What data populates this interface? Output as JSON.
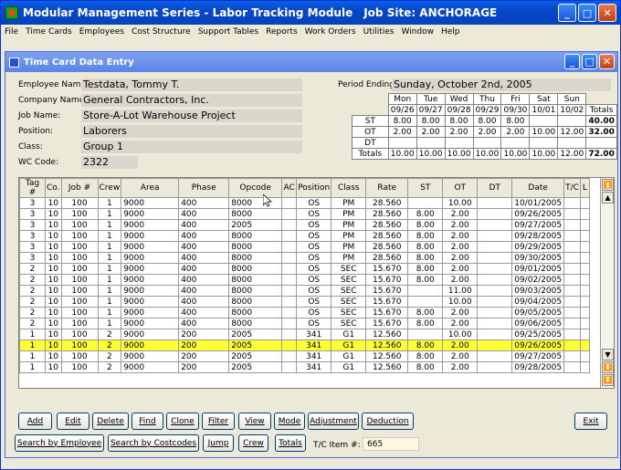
{
  "window": {
    "title": "Modular Management Series - Labor Tracking Module",
    "job_site": "Job Site: ANCHORAGE"
  },
  "menu": [
    "File",
    "Time Cards",
    "Employees",
    "Cost Structure",
    "Support Tables",
    "Reports",
    "Work Orders",
    "Utilities",
    "Window",
    "Help"
  ],
  "child": {
    "title": "Time Card Data Entry"
  },
  "employee": {
    "name_label": "Employee Name:",
    "name": "Testdata, Tommy T.",
    "company_label": "Company Name:",
    "company": "General Contractors, Inc.",
    "job_label": "Job Name:",
    "job": "Store-A-Lot Warehouse Project",
    "position_label": "Position:",
    "position": "Laborers",
    "class_label": "Class:",
    "class": "Group 1",
    "wc_label": "WC Code:",
    "wc": "2322"
  },
  "period": {
    "label": "Period Ending:",
    "value": "Sunday, October 2nd, 2005"
  },
  "hours": {
    "days": [
      "Mon",
      "Tue",
      "Wed",
      "Thu",
      "Fri",
      "Sat",
      "Sun"
    ],
    "dates": [
      "09/26",
      "09/27",
      "09/28",
      "09/29",
      "09/30",
      "10/01",
      "10/02"
    ],
    "totals_label": "Totals",
    "rows": [
      {
        "label": "ST",
        "values": [
          "8.00",
          "8.00",
          "8.00",
          "8.00",
          "8.00",
          "",
          ""
        ],
        "total": "40.00"
      },
      {
        "label": "OT",
        "values": [
          "2.00",
          "2.00",
          "2.00",
          "2.00",
          "2.00",
          "10.00",
          "12.00"
        ],
        "total": "32.00"
      },
      {
        "label": "DT",
        "values": [
          "",
          "",
          "",
          "",
          "",
          "",
          ""
        ],
        "total": ""
      },
      {
        "label": "Totals",
        "values": [
          "10.00",
          "10.00",
          "10.00",
          "10.00",
          "10.00",
          "10.00",
          "12.00"
        ],
        "total": "72.00"
      }
    ]
  },
  "grid": {
    "columns": [
      "Tag #",
      "Co.",
      "Job #",
      "Crew",
      "Area",
      "Phase",
      "Opcode",
      "AC",
      "Position",
      "Class",
      "Rate",
      "ST",
      "OT",
      "DT",
      "Date",
      "T/C",
      "L"
    ],
    "rows": [
      [
        "3",
        "10",
        "100",
        "1",
        "9000",
        "400",
        "8000",
        "",
        "OS",
        "PM",
        "28.560",
        "",
        "10.00",
        "",
        "10/01/2005",
        "",
        ""
      ],
      [
        "3",
        "10",
        "100",
        "1",
        "9000",
        "400",
        "8000",
        "",
        "OS",
        "PM",
        "28.560",
        "8.00",
        "2.00",
        "",
        "09/26/2005",
        "",
        ""
      ],
      [
        "3",
        "10",
        "100",
        "1",
        "9000",
        "400",
        "2005",
        "",
        "OS",
        "PM",
        "28.560",
        "8.00",
        "2.00",
        "",
        "09/27/2005",
        "",
        ""
      ],
      [
        "3",
        "10",
        "100",
        "1",
        "9000",
        "400",
        "8000",
        "",
        "OS",
        "PM",
        "28.560",
        "8.00",
        "2.00",
        "",
        "09/28/2005",
        "",
        ""
      ],
      [
        "3",
        "10",
        "100",
        "1",
        "9000",
        "400",
        "8000",
        "",
        "OS",
        "PM",
        "28.560",
        "8.00",
        "2.00",
        "",
        "09/29/2005",
        "",
        ""
      ],
      [
        "3",
        "10",
        "100",
        "1",
        "9000",
        "400",
        "8000",
        "",
        "OS",
        "PM",
        "28.560",
        "8.00",
        "2.00",
        "",
        "09/30/2005",
        "",
        ""
      ],
      [
        "2",
        "10",
        "100",
        "1",
        "9000",
        "400",
        "8000",
        "",
        "OS",
        "SEC",
        "15.670",
        "8.00",
        "2.00",
        "",
        "09/01/2005",
        "",
        ""
      ],
      [
        "2",
        "10",
        "100",
        "1",
        "9000",
        "400",
        "8000",
        "",
        "OS",
        "SEC",
        "15.670",
        "8.00",
        "2.00",
        "",
        "09/02/2005",
        "",
        ""
      ],
      [
        "2",
        "10",
        "100",
        "1",
        "9000",
        "400",
        "8000",
        "",
        "OS",
        "SEC",
        "15.670",
        "",
        "11.00",
        "",
        "09/03/2005",
        "",
        ""
      ],
      [
        "2",
        "10",
        "100",
        "1",
        "9000",
        "400",
        "8000",
        "",
        "OS",
        "SEC",
        "15.670",
        "",
        "10.00",
        "",
        "09/04/2005",
        "",
        ""
      ],
      [
        "2",
        "10",
        "100",
        "1",
        "9000",
        "400",
        "8000",
        "",
        "OS",
        "SEC",
        "15.670",
        "8.00",
        "2.00",
        "",
        "09/05/2005",
        "",
        ""
      ],
      [
        "2",
        "10",
        "100",
        "1",
        "9000",
        "400",
        "8000",
        "",
        "OS",
        "SEC",
        "15.670",
        "8.00",
        "2.00",
        "",
        "09/06/2005",
        "",
        ""
      ],
      [
        "1",
        "10",
        "100",
        "2",
        "9000",
        "200",
        "2005",
        "",
        "341",
        "G1",
        "12.560",
        "",
        "10.00",
        "",
        "09/25/2005",
        "",
        ""
      ],
      [
        "1",
        "10",
        "100",
        "2",
        "9000",
        "200",
        "2005",
        "",
        "341",
        "G1",
        "12.560",
        "8.00",
        "2.00",
        "",
        "09/26/2005",
        "",
        ""
      ],
      [
        "1",
        "10",
        "100",
        "2",
        "9000",
        "200",
        "2005",
        "",
        "341",
        "G1",
        "12.560",
        "8.00",
        "2.00",
        "",
        "09/27/2005",
        "",
        ""
      ],
      [
        "1",
        "10",
        "100",
        "2",
        "9000",
        "200",
        "2005",
        "",
        "341",
        "G1",
        "12.560",
        "8.00",
        "2.00",
        "",
        "09/28/2005",
        "",
        ""
      ]
    ],
    "selected_row": 13
  },
  "buttons": {
    "add": "Add",
    "edit": "Edit",
    "delete": "Delete",
    "find": "Find",
    "clone": "Clone",
    "filter": "Filter",
    "view": "View",
    "mode": "Mode",
    "adjustment": "Adjustment",
    "deduction": "Deduction",
    "exit": "Exit",
    "search_employee": "Search by Employee",
    "search_costcodes": "Search by Costcodes",
    "jump": "Jump",
    "crew": "Crew",
    "totals": "Totals"
  },
  "tc_item": {
    "label": "T/C Item #:",
    "value": "665"
  },
  "colors": {
    "selected_row": "#ffff33",
    "title_blue": "#0747c9"
  }
}
